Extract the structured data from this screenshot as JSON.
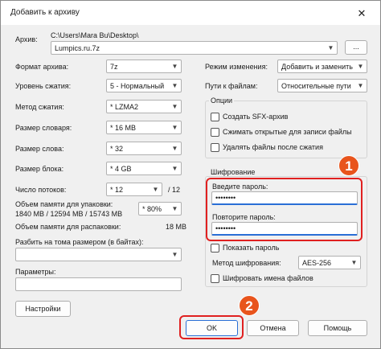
{
  "window": {
    "title": "Добавить к архиву",
    "close_glyph": "✕"
  },
  "archive": {
    "label": "Архив:",
    "path": "C:\\Users\\Mara Bu\\Desktop\\",
    "filename": "Lumpics.ru.7z",
    "browse_label": "..."
  },
  "left": {
    "format_label": "Формат архива:",
    "format_value": "7z",
    "level_label": "Уровень сжатия:",
    "level_value": "5 - Нормальный",
    "method_label": "Метод сжатия:",
    "method_value": "*  LZMA2",
    "dict_label": "Размер словаря:",
    "dict_value": "*  16 MB",
    "word_label": "Размер слова:",
    "word_value": "*  32",
    "block_label": "Размер блока:",
    "block_value": "*  4 GB",
    "threads_label": "Число потоков:",
    "threads_value": "*  12",
    "threads_total": "/  12",
    "mem_pack_label": "Объем памяти для упаковки:",
    "mem_pack_values": "1840 MB / 12594 MB / 15743 MB",
    "mem_pack_percent": "*  80%",
    "mem_unpack_label": "Объем памяти для распаковки:",
    "mem_unpack_value": "18 MB",
    "split_label": "Разбить на тома размером (в байтах):",
    "params_label": "Параметры:",
    "settings_button": "Настройки"
  },
  "right": {
    "update_label": "Режим изменения:",
    "update_value": "Добавить и заменить",
    "paths_label": "Пути к файлам:",
    "paths_value": "Относительные пути",
    "options_title": "Опции",
    "opt_sfx": "Создать SFX-архив",
    "opt_shared": "Сжимать открытые для записи файлы",
    "opt_delete": "Удалять файлы после сжатия",
    "enc_title": "Шифрование",
    "enc_pwd_label": "Введите пароль:",
    "enc_pwd_value": "••••••••",
    "enc_repeat_label": "Повторите пароль:",
    "enc_repeat_value": "••••••••",
    "show_pwd": "Показать пароль",
    "enc_method_label": "Метод шифрования:",
    "enc_method_value": "AES-256",
    "encrypt_names": "Шифровать имена файлов"
  },
  "buttons": {
    "ok": "OK",
    "cancel": "Отмена",
    "help": "Помощь"
  },
  "annotations": {
    "badge1": "1",
    "badge2": "2"
  },
  "colors": {
    "highlight": "#e02020",
    "badge": "#e8541c",
    "focus": "#2a6fd6"
  }
}
